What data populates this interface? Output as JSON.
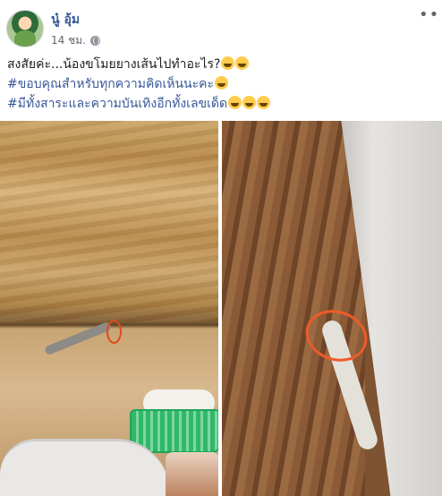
{
  "post": {
    "author": "นู๋ อุ้ม",
    "time": "14 ชม.",
    "more_label": "•••",
    "lines": [
      "สงสัยค่ะ...น้องขโมยยางเส้นไปทำอะไร?",
      "#ขอบคุณสำหรับทุกความคิดเห็นนะคะ",
      "#มีทั้งสาระและความบันเทิงอีกทั้งเลขเด็ด"
    ]
  },
  "colors": {
    "link": "#385898",
    "meta": "#616770",
    "text": "#1c1e21"
  },
  "icons": {
    "avatar": "profile-photo",
    "privacy": "globe-icon",
    "emoji_grin": "grinning-face",
    "emoji_laugh": "face-with-tears-of-joy"
  },
  "photos": [
    "gecko-under-shelf-with-rubber-band",
    "gecko-on-wall-with-rubber-band"
  ]
}
